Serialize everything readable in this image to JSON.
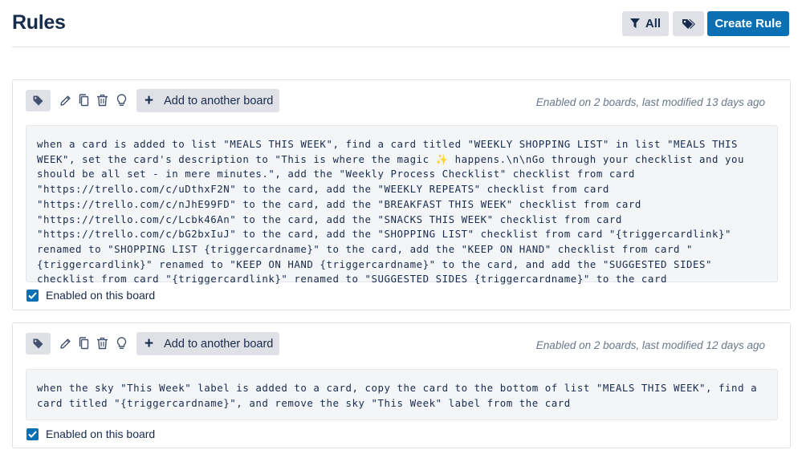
{
  "header": {
    "title": "Rules",
    "filter_label": "All",
    "create_label": "Create Rule"
  },
  "rules": [
    {
      "add_board_label": "Add to another board",
      "meta": "Enabled on 2 boards, last modified 13 days ago",
      "description": "when a card is added to list \"MEALS THIS WEEK\", find a card titled \"WEEKLY SHOPPING LIST\" in list \"MEALS THIS WEEK\", set the card's description to \"This is where the magic ✨ happens.\\n\\nGo through your checklist and you should be all set - in mere minutes.\", add the \"Weekly Process Checklist\" checklist from card \"https://trello.com/c/uDthxF2N\" to the card, add the \"WEEKLY REPEATS\" checklist from card \"https://trello.com/c/nJhE99FD\" to the card, add the \"BREAKFAST THIS WEEK\" checklist from card \"https://trello.com/c/Lcbk46An\" to the card, add the \"SNACKS THIS WEEK\" checklist from card \"https://trello.com/c/bG2bxIuJ\" to the card, add the \"SHOPPING LIST\" checklist from card \"{triggercardlink}\" renamed to \"SHOPPING LIST {triggercardname}\" to the card, add the \"KEEP ON HAND\" checklist from card \"{triggercardlink}\" renamed to \"KEEP ON HAND {triggercardname}\" to the card, and add the \"SUGGESTED SIDES\" checklist from card \"{triggercardlink}\" renamed to \"SUGGESTED SIDES {triggercardname}\" to the card",
      "enabled_label": "Enabled on this board",
      "enabled": true
    },
    {
      "add_board_label": "Add to another board",
      "meta": "Enabled on 2 boards, last modified 12 days ago",
      "description": "when the sky \"This Week\" label is added to a card, copy the card to the bottom of list \"MEALS THIS WEEK\", find a card titled \"{triggercardname}\", and remove the sky \"This Week\" label from the card",
      "enabled_label": "Enabled on this board",
      "enabled": true
    }
  ],
  "colors": {
    "accent": "#0b6fb3",
    "button_bg": "#dfe1e6",
    "code_bg": "#f4f5f7",
    "text": "#172b4d",
    "muted": "#6b778c"
  },
  "icons": [
    "filter-icon",
    "tag-icon",
    "pencil-icon",
    "copy-icon",
    "trash-icon",
    "lightbulb-icon",
    "plus-icon",
    "checkmark-icon"
  ]
}
